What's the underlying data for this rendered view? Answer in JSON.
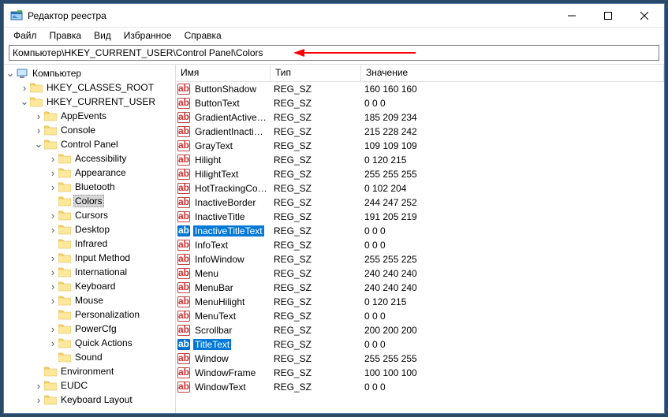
{
  "window": {
    "title": "Редактор реестра"
  },
  "menu": {
    "file": "Файл",
    "edit": "Правка",
    "view": "Вид",
    "favorites": "Избранное",
    "help": "Справка"
  },
  "address": "Компьютер\\HKEY_CURRENT_USER\\Control Panel\\Colors",
  "tree": {
    "root": "Компьютер",
    "hkcr": "HKEY_CLASSES_ROOT",
    "hkcu": "HKEY_CURRENT_USER",
    "appEvents": "AppEvents",
    "console": "Console",
    "controlPanel": "Control Panel",
    "accessibility": "Accessibility",
    "appearance": "Appearance",
    "bluetooth": "Bluetooth",
    "colors": "Colors",
    "cursors": "Cursors",
    "desktop": "Desktop",
    "infrared": "Infrared",
    "inputMethod": "Input Method",
    "international": "International",
    "keyboard": "Keyboard",
    "mouse": "Mouse",
    "personalization": "Personalization",
    "powerCfg": "PowerCfg",
    "quickActions": "Quick Actions",
    "sound": "Sound",
    "environment": "Environment",
    "eudc": "EUDC",
    "keyboardLayout": "Keyboard Layout"
  },
  "columns": {
    "name": "Имя",
    "type": "Тип",
    "value": "Значение"
  },
  "values": [
    {
      "name": "ButtonShadow",
      "type": "REG_SZ",
      "data": "160 160 160",
      "selected": false
    },
    {
      "name": "ButtonText",
      "type": "REG_SZ",
      "data": "0 0 0",
      "selected": false
    },
    {
      "name": "GradientActiveT...",
      "type": "REG_SZ",
      "data": "185 209 234",
      "selected": false
    },
    {
      "name": "GradientInactive...",
      "type": "REG_SZ",
      "data": "215 228 242",
      "selected": false
    },
    {
      "name": "GrayText",
      "type": "REG_SZ",
      "data": "109 109 109",
      "selected": false
    },
    {
      "name": "Hilight",
      "type": "REG_SZ",
      "data": "0 120 215",
      "selected": false
    },
    {
      "name": "HilightText",
      "type": "REG_SZ",
      "data": "255 255 255",
      "selected": false
    },
    {
      "name": "HotTrackingColor",
      "type": "REG_SZ",
      "data": "0 102 204",
      "selected": false
    },
    {
      "name": "InactiveBorder",
      "type": "REG_SZ",
      "data": "244 247 252",
      "selected": false
    },
    {
      "name": "InactiveTitle",
      "type": "REG_SZ",
      "data": "191 205 219",
      "selected": false
    },
    {
      "name": "InactiveTitleText",
      "type": "REG_SZ",
      "data": "0 0 0",
      "selected": true
    },
    {
      "name": "InfoText",
      "type": "REG_SZ",
      "data": "0 0 0",
      "selected": false
    },
    {
      "name": "InfoWindow",
      "type": "REG_SZ",
      "data": "255 255 225",
      "selected": false
    },
    {
      "name": "Menu",
      "type": "REG_SZ",
      "data": "240 240 240",
      "selected": false
    },
    {
      "name": "MenuBar",
      "type": "REG_SZ",
      "data": "240 240 240",
      "selected": false
    },
    {
      "name": "MenuHilight",
      "type": "REG_SZ",
      "data": "0 120 215",
      "selected": false
    },
    {
      "name": "MenuText",
      "type": "REG_SZ",
      "data": "0 0 0",
      "selected": false
    },
    {
      "name": "Scrollbar",
      "type": "REG_SZ",
      "data": "200 200 200",
      "selected": false
    },
    {
      "name": "TitleText",
      "type": "REG_SZ",
      "data": "0 0 0",
      "selected": true
    },
    {
      "name": "Window",
      "type": "REG_SZ",
      "data": "255 255 255",
      "selected": false
    },
    {
      "name": "WindowFrame",
      "type": "REG_SZ",
      "data": "100 100 100",
      "selected": false
    },
    {
      "name": "WindowText",
      "type": "REG_SZ",
      "data": "0 0 0",
      "selected": false
    }
  ]
}
